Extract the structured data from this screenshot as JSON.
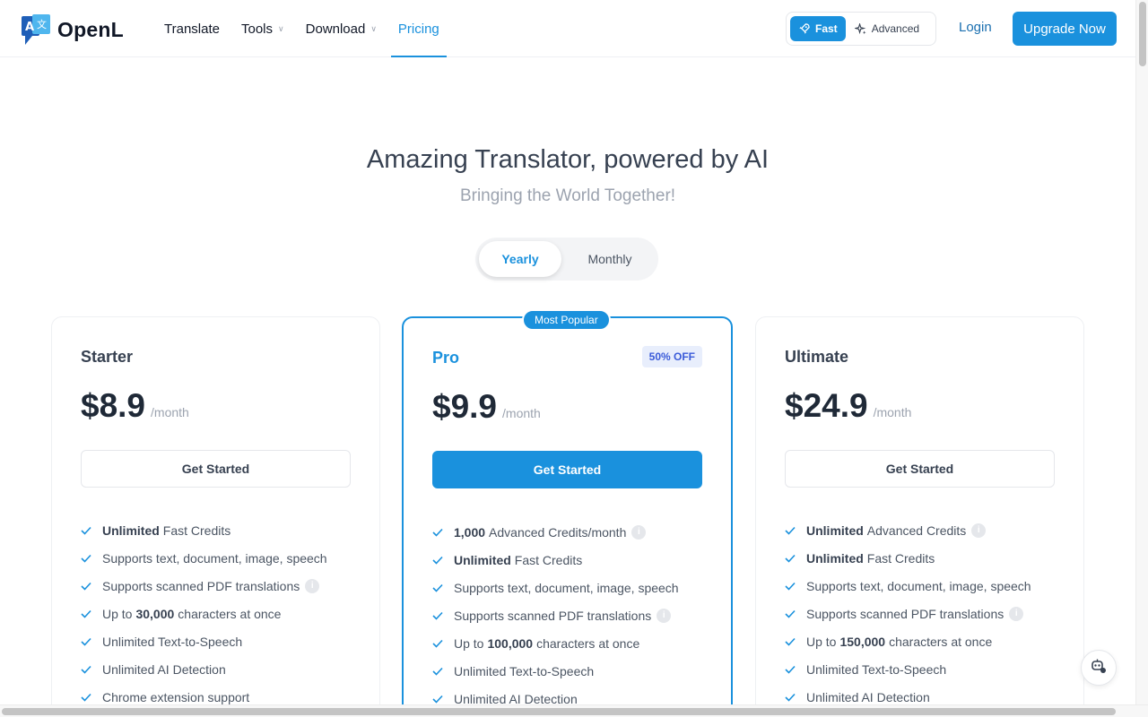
{
  "brand": {
    "name": "OpenL",
    "logo_glyph_a": "A",
    "logo_glyph_b": "文"
  },
  "nav": {
    "items": [
      {
        "label": "Translate",
        "has_dropdown": false,
        "active": false
      },
      {
        "label": "Tools",
        "has_dropdown": true,
        "active": false
      },
      {
        "label": "Download",
        "has_dropdown": true,
        "active": false
      },
      {
        "label": "Pricing",
        "has_dropdown": false,
        "active": true
      }
    ]
  },
  "mode": {
    "fast_label": "Fast",
    "advanced_label": "Advanced",
    "selected": "Fast"
  },
  "auth": {
    "login_label": "Login",
    "upgrade_label": "Upgrade Now"
  },
  "hero": {
    "title": "Amazing Translator, powered by AI",
    "subtitle": "Bringing the World Together!"
  },
  "billing": {
    "yearly_label": "Yearly",
    "monthly_label": "Monthly",
    "selected": "Yearly"
  },
  "plans": [
    {
      "name": "Starter",
      "price": "$8.9",
      "unit": "/month",
      "cta": "Get Started",
      "features": [
        {
          "bold": "Unlimited",
          "text": "Fast Credits",
          "info": false
        },
        {
          "bold": "",
          "text": "Supports text, document, image, speech",
          "info": false
        },
        {
          "bold": "",
          "text": "Supports scanned PDF translations",
          "info": true
        },
        {
          "pre": "Up to",
          "bold": "30,000",
          "text": "characters at once",
          "info": false
        },
        {
          "bold": "",
          "text": "Unlimited Text-to-Speech",
          "info": false
        },
        {
          "bold": "",
          "text": "Unlimited AI Detection",
          "info": false
        },
        {
          "bold": "",
          "text": "Chrome extension support",
          "info": false
        }
      ]
    },
    {
      "name": "Pro",
      "badge": "Most Popular",
      "discount": "50% OFF",
      "price": "$9.9",
      "unit": "/month",
      "cta": "Get Started",
      "features": [
        {
          "bold": "1,000",
          "text": "Advanced Credits/month",
          "info": true
        },
        {
          "bold": "Unlimited",
          "text": "Fast Credits",
          "info": false
        },
        {
          "bold": "",
          "text": "Supports text, document, image, speech",
          "info": false
        },
        {
          "bold": "",
          "text": "Supports scanned PDF translations",
          "info": true
        },
        {
          "pre": "Up to",
          "bold": "100,000",
          "text": "characters at once",
          "info": false
        },
        {
          "bold": "",
          "text": "Unlimited Text-to-Speech",
          "info": false
        },
        {
          "bold": "",
          "text": "Unlimited AI Detection",
          "info": false
        }
      ]
    },
    {
      "name": "Ultimate",
      "price": "$24.9",
      "unit": "/month",
      "cta": "Get Started",
      "features": [
        {
          "bold": "Unlimited",
          "text": "Advanced Credits",
          "info": true
        },
        {
          "bold": "Unlimited",
          "text": "Fast Credits",
          "info": false
        },
        {
          "bold": "",
          "text": "Supports text, document, image, speech",
          "info": false
        },
        {
          "bold": "",
          "text": "Supports scanned PDF translations",
          "info": true
        },
        {
          "pre": "Up to",
          "bold": "150,000",
          "text": "characters at once",
          "info": false
        },
        {
          "bold": "",
          "text": "Unlimited Text-to-Speech",
          "info": false
        },
        {
          "bold": "",
          "text": "Unlimited AI Detection",
          "info": false
        }
      ]
    }
  ],
  "colors": {
    "accent": "#1a91dd",
    "discount_bg": "#e8eefc",
    "discount_text": "#3a5bd9"
  },
  "icons": {
    "check": "check-icon",
    "info": "info-icon",
    "fast": "rocket-icon",
    "advanced": "sparkle-icon",
    "help": "robot-help-icon"
  }
}
